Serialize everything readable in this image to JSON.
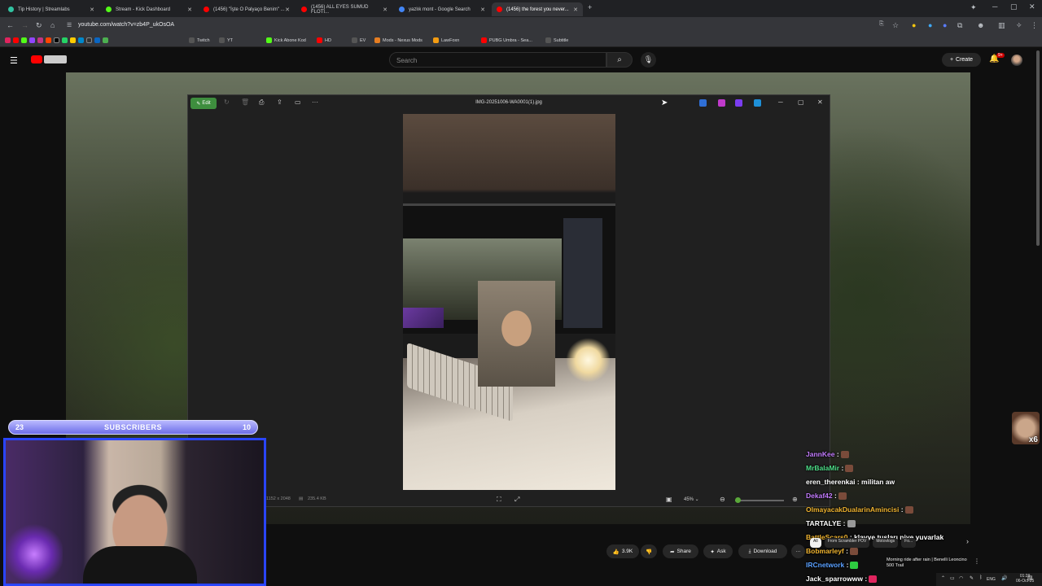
{
  "browser": {
    "tabs": [
      {
        "title": "Tip History | Streamlabs",
        "color": "#31c3a2",
        "active": false
      },
      {
        "title": "Stream - Kick Dashboard",
        "color": "#53fc18",
        "active": false
      },
      {
        "title": "(1456) \"İşte O Palyaço Benim\" ...",
        "color": "#ff0000",
        "active": false
      },
      {
        "title": "(1456) ALL EYES SUMUD FLOTI...",
        "color": "#ff0000",
        "active": false
      },
      {
        "title": "yazlık mont - Google Search",
        "color": "#4285f4",
        "active": false
      },
      {
        "title": "(1456) the forest you never...",
        "color": "#ff0000",
        "active": true
      }
    ],
    "url": "youtube.com/watch?v=zb4P_ukOsOA",
    "bookmarks": [
      "Twitch",
      "YT",
      "Kick Abone Kod",
      "HD",
      "EV",
      "Mods - Nexus Mods",
      "LawFoxn",
      "PUBG Umbra - Sea...",
      "Subtitle"
    ]
  },
  "youtube": {
    "search_placeholder": "Search",
    "create_label": "Create",
    "notif_count": "9+",
    "actions": {
      "likes": "3.9K",
      "share": "Share",
      "ask": "Ask",
      "download": "Download"
    },
    "chips": [
      "All",
      "From Scrambler POV",
      "Motovlogs",
      "Fo..."
    ],
    "recommendation": "Morning ride after rain | Benelli Leoncino 500 Trail"
  },
  "photo_viewer": {
    "edit_label": "Edit",
    "filename": "IMG-20251006-WA0001(1).jpg",
    "dimensions": "1152 x 2048",
    "filesize": "235.4 KB",
    "zoom": "45%",
    "zoom_level": 0.05
  },
  "overlay": {
    "sub_left": "23",
    "sub_title": "SUBSCRIBERS",
    "sub_right": "10",
    "multiplier": "x6"
  },
  "chat": [
    {
      "user": "JannKee",
      "msg": ":",
      "color": "#c47cff",
      "emote": true
    },
    {
      "user": "MrBalaMir",
      "msg": ":",
      "color": "#4fe08a",
      "emote": true
    },
    {
      "user": "eren_therenkai",
      "msg": ": militan aw",
      "color": "#ffffff",
      "emote": false
    },
    {
      "user": "Dekaf42",
      "msg": ":",
      "color": "#c47cff",
      "emote": true
    },
    {
      "user": "OlmayacakDualarinAmincisi",
      "msg": ":",
      "color": "#f0b430",
      "emote": true
    },
    {
      "user": "TARTALYE",
      "msg": ":",
      "color": "#ffffff",
      "emote": true
    },
    {
      "user": "BattleScars0",
      "msg": ": klavye tuşları niye yuvarlak",
      "color": "#f0b430",
      "emote": false
    },
    {
      "user": "Bobmarleyf",
      "msg": ":",
      "color": "#f0b430",
      "emote": true
    },
    {
      "user": "IRCnetwork",
      "msg": ":",
      "color": "#5aa0ff",
      "emote": true
    },
    {
      "user": "Jack_sparrowww",
      "msg": ":",
      "color": "#ffffff",
      "emote": true
    }
  ],
  "tray": {
    "lang": "ENG",
    "time": "01:29",
    "date": "06-Oct-25"
  }
}
